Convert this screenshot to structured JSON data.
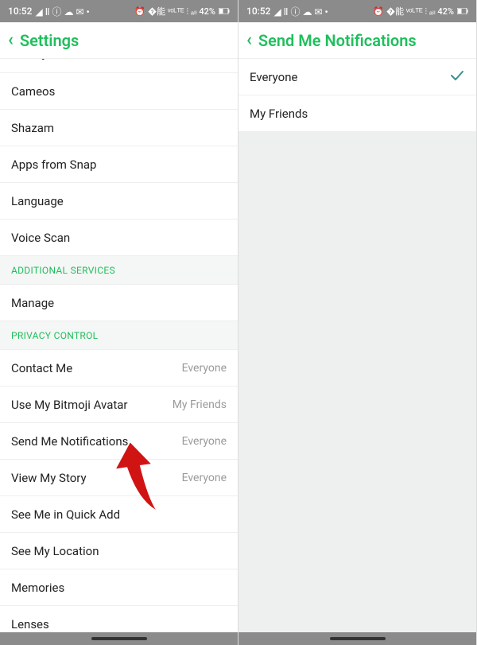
{
  "status": {
    "time": "10:52",
    "left_icons": "◢ Ⅱ ⓘ ☁ ✉ •",
    "right_icons": "⏰ �能 ᵛᵒᴸᵀᴱ ⫶ ₐₗₗ 42%",
    "battery": "42%"
  },
  "left": {
    "title": "Settings",
    "items_top": [
      "Bitmoji",
      "Cameos",
      "Shazam",
      "Apps from Snap",
      "Language",
      "Voice Scan"
    ],
    "section1": "ADDITIONAL SERVICES",
    "manage": "Manage",
    "section2": "PRIVACY CONTROL",
    "privacy": [
      {
        "label": "Contact Me",
        "val": "Everyone"
      },
      {
        "label": "Use My Bitmoji Avatar",
        "val": "My Friends"
      },
      {
        "label": "Send Me Notifications",
        "val": "Everyone"
      },
      {
        "label": "View My Story",
        "val": "Everyone"
      },
      {
        "label": "See Me in Quick Add",
        "val": ""
      },
      {
        "label": "See My Location",
        "val": ""
      },
      {
        "label": "Memories",
        "val": ""
      },
      {
        "label": "Lenses",
        "val": ""
      }
    ]
  },
  "right": {
    "title": "Send Me Notifications",
    "options": [
      {
        "label": "Everyone",
        "selected": true
      },
      {
        "label": "My Friends",
        "selected": false
      }
    ]
  }
}
